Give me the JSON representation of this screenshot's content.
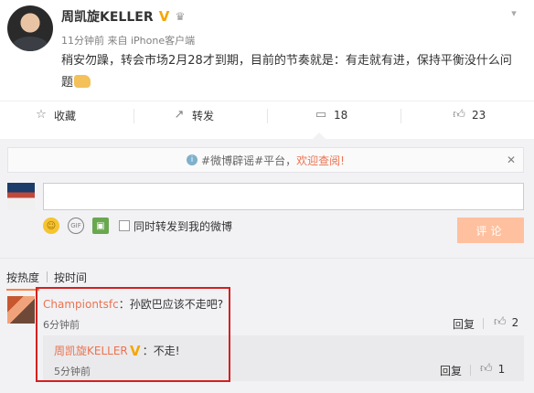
{
  "post": {
    "username": "周凯旋KELLER",
    "verified_badge": "V",
    "badge_icon": "crown-icon",
    "time": "11分钟前",
    "source": "来自 iPhone客户端",
    "text": "稍安勿躁，转会市场2月28才到期，目前的节奏就是：有走就有进，保持平衡没什么问题",
    "emoji": "thumbs-up-emoji"
  },
  "actions": {
    "favorite_label": "收藏",
    "forward_label": "转发",
    "comment_count": "18",
    "like_count": "23"
  },
  "notice": {
    "prefix": "#微博辟谣#平台，",
    "link": "欢迎查阅!"
  },
  "composer": {
    "input_value": "",
    "also_forward_label": "同时转发到我的微博",
    "submit_label": "评论"
  },
  "sort": {
    "by_hot": "按热度",
    "by_time": "按时间"
  },
  "comment": {
    "user": "Championtsfc",
    "text": "：孙欧巴应该不走吧?",
    "time": "6分钟前",
    "reply_label": "回复",
    "like_count": "2"
  },
  "sub_reply": {
    "user": "周凯旋KELLER",
    "verified_badge": "V",
    "text": "：不走!",
    "time": "5分钟前",
    "reply_label": "回复",
    "like_count": "1"
  },
  "colors": {
    "accent": "#eb7350",
    "verified": "#f7a600",
    "highlight_border": "#d42020",
    "submit_disabled": "#ffc09f"
  }
}
